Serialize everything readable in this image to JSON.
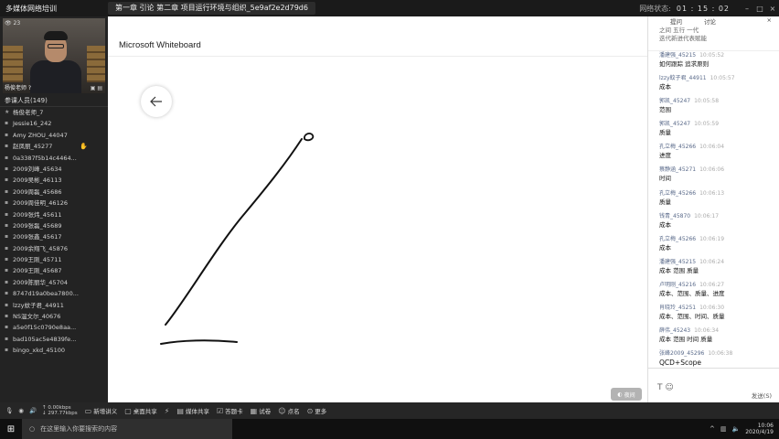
{
  "titlebar": {
    "app_title": "多媒体网络培训",
    "tab_title": "第一章 引论   第二章 项目运行环境与组织_5e9af2e2d79d6",
    "net_status": "网络状态:",
    "timer": "01 : 15 : 02"
  },
  "video": {
    "viewer_count": "23",
    "teacher_name": "杨俊老师 ?"
  },
  "members": {
    "header": "参课人员(149)",
    "items": [
      {
        "icon": "teacher-icon",
        "name": "杨俊老师_7"
      },
      {
        "icon": "student-icon",
        "name": "Jessie16_242"
      },
      {
        "icon": "student-icon",
        "name": "Amy ZHOU_44047"
      },
      {
        "icon": "student-icon",
        "name": "赵凤丽_45277",
        "hand": true
      },
      {
        "icon": "student-icon",
        "name": "0a3387f5b14c4464..."
      },
      {
        "icon": "student-icon",
        "name": "2009刘峰_45634"
      },
      {
        "icon": "student-icon",
        "name": "2009吴彬_46113"
      },
      {
        "icon": "student-icon",
        "name": "2009周磊_45686"
      },
      {
        "icon": "student-icon",
        "name": "2009周佳明_46126"
      },
      {
        "icon": "student-icon",
        "name": "2009张炜_45611"
      },
      {
        "icon": "student-icon",
        "name": "2009张磊_45689"
      },
      {
        "icon": "student-icon",
        "name": "2009张鑫_45617"
      },
      {
        "icon": "student-icon",
        "name": "2009余翔飞_45876"
      },
      {
        "icon": "student-icon",
        "name": "2009王刚_45711"
      },
      {
        "icon": "student-icon",
        "name": "2009王刚_45687"
      },
      {
        "icon": "student-icon",
        "name": "2009陈丽华_45704"
      },
      {
        "icon": "student-icon",
        "name": "8747d19a0bea7800..."
      },
      {
        "icon": "student-icon",
        "name": "lzzy蚊子君_44911"
      },
      {
        "icon": "student-icon",
        "name": "NS温文尔_40676"
      },
      {
        "icon": "student-icon",
        "name": "a5e0f15c0790e8aa..."
      },
      {
        "icon": "student-icon",
        "name": "bad105ac5e4839fe..."
      },
      {
        "icon": "student-icon",
        "name": "bingo_xkd_45100"
      }
    ]
  },
  "board": {
    "title": "Microsoft Whiteboard",
    "dark_badge": "夜间"
  },
  "chat": {
    "tabs": [
      "提问",
      "讨论"
    ],
    "top_lines": [
      "之间 五行 一代",
      "迭代新进代表赋能"
    ],
    "messages": [
      {
        "who": "潘建强_45215",
        "time": "10:05:52",
        "text": "如何跟踪 追求原则"
      },
      {
        "who": "lzzy蚊子君_44911",
        "time": "10:05:57",
        "text": "成本"
      },
      {
        "who": "郭凯_45247",
        "time": "10:05:58",
        "text": "范围"
      },
      {
        "who": "郭凯_45247",
        "time": "10:05:59",
        "text": "质量"
      },
      {
        "who": "孔立梅_45266",
        "time": "10:06:04",
        "text": "进度"
      },
      {
        "who": "蔡静涵_45271",
        "time": "10:06:06",
        "text": "时间"
      },
      {
        "who": "孔立梅_45266",
        "time": "10:06:13",
        "text": "质量"
      },
      {
        "who": "钱青_45870",
        "time": "10:06:17",
        "text": "成本"
      },
      {
        "who": "孔立梅_45266",
        "time": "10:06:19",
        "text": "成本"
      },
      {
        "who": "潘建强_45215",
        "time": "10:06:24",
        "text": "成本 范围 质量"
      },
      {
        "who": "卢明刚_45216",
        "time": "10:06:27",
        "text": "成本、范围、质量、进度"
      },
      {
        "who": "肖晓玲_45251",
        "time": "10:06:30",
        "text": "成本、范围、时间、质量"
      },
      {
        "who": "薛伟_45243",
        "time": "10:06:34",
        "text": "成本 范围 时间 质量"
      },
      {
        "who": "张峰2009_45296",
        "time": "10:06:38",
        "text": "QCD+Scope",
        "big": true
      }
    ],
    "input_tools": "T ☺",
    "send_label": "发送(S)"
  },
  "toolbar": {
    "speed_up": "↑ 0.00kbps",
    "speed_down": "↓ 297.77kbps",
    "buttons": [
      "新增讲义",
      "桌面共享",
      "媒体共享",
      "答题卡",
      "试卷",
      "点名",
      "更多"
    ]
  },
  "taskbar": {
    "search_placeholder": "在这里输入你要搜索的内容",
    "time": "10:06",
    "date": "2020/4/19"
  }
}
